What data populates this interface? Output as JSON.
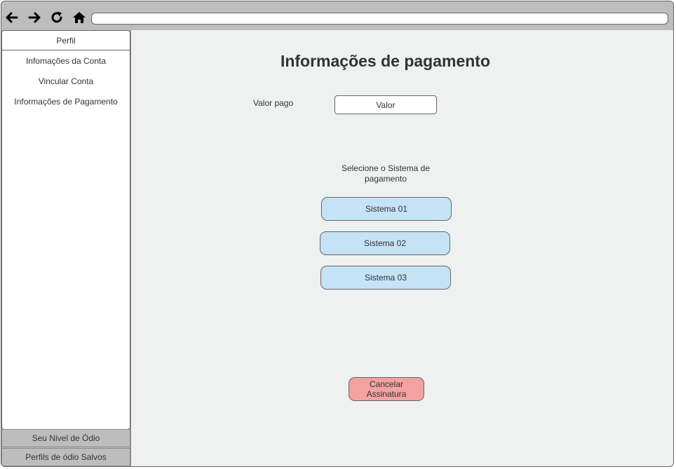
{
  "browser": {
    "url": ""
  },
  "sidebar": {
    "header": "Perfil",
    "items": [
      {
        "label": "Infomações da Conta"
      },
      {
        "label": "Vincular Conta"
      },
      {
        "label": "Informações de Pagamento"
      }
    ],
    "bottom_items": [
      {
        "label": "Seu Nivel de Ódio"
      },
      {
        "label": "Perfils de ódio Salvos"
      }
    ]
  },
  "main": {
    "title": "Informações de pagamento",
    "valor_label": "Valor pago",
    "valor_value": "Valor",
    "select_label": "Selecione o Sistema de pagamento",
    "systems": [
      {
        "label": "Sistema 01"
      },
      {
        "label": "Sistema 02"
      },
      {
        "label": "Sistema 03"
      }
    ],
    "cancel_label": "Cancelar Assinatura"
  },
  "colors": {
    "system_button_bg": "#c5e3f6",
    "cancel_button_bg": "#f4a1a1",
    "content_bg": "#eff0f0",
    "chrome_bg": "#bdbdbd"
  }
}
